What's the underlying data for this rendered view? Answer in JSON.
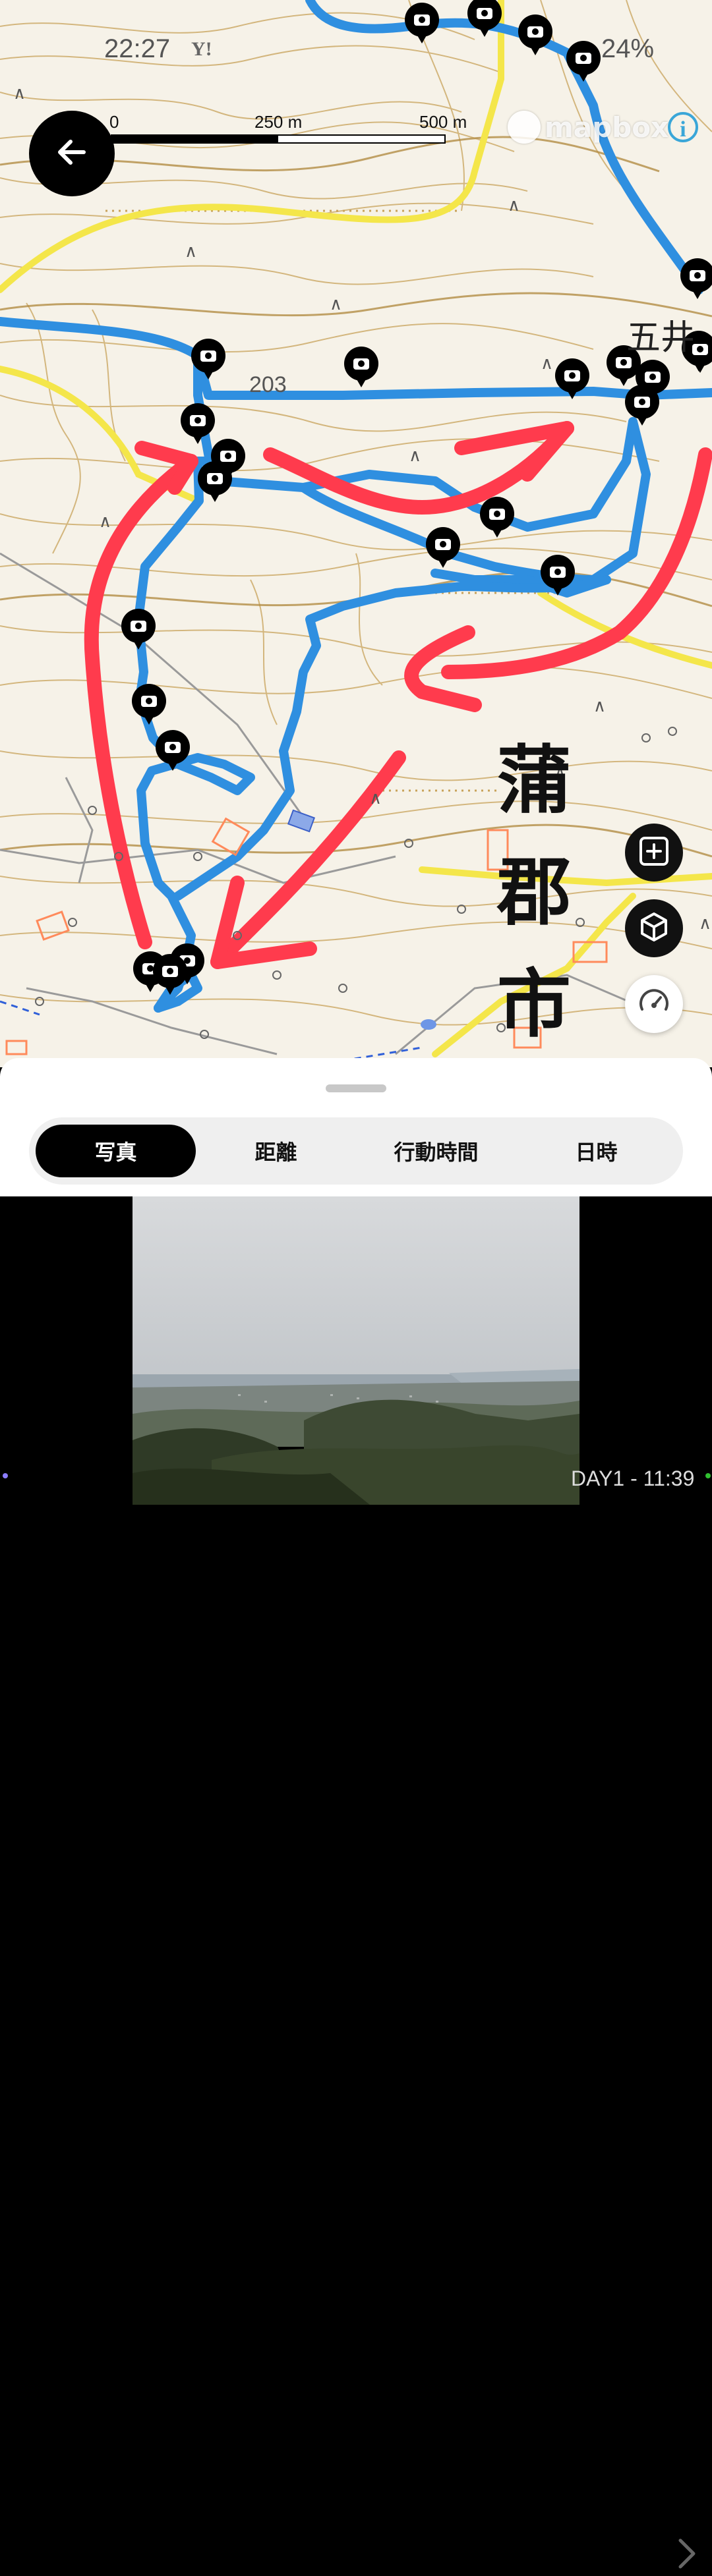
{
  "status_bar": {
    "time": "22:27",
    "carrier_icon": "Y!",
    "battery": "24%"
  },
  "map": {
    "back_icon": "arrow-left-icon",
    "scale": {
      "labels": [
        "0",
        "250 m",
        "500 m"
      ]
    },
    "attribution": "mapbox",
    "info_icon": "i",
    "city_label": "蒲郡市",
    "place_label": "五井",
    "road_label": "203",
    "route_color": "#2f8fe0",
    "arrow_color": "#ff3b4d",
    "yellow_road_color": "#f4e64a",
    "contour_color": "#c8a25a",
    "buttons": {
      "zoom_icon": "zoom-frame-icon",
      "cube_icon": "3d-cube-icon",
      "speed_icon": "speedometer-icon"
    }
  },
  "bottom_sheet": {
    "tabs": [
      {
        "label": "写真",
        "active": true
      },
      {
        "label": "距離",
        "active": false
      },
      {
        "label": "行動時間",
        "active": false
      },
      {
        "label": "日時",
        "active": false
      }
    ]
  },
  "photo_viewer": {
    "caption": "DAY1 - 11:39",
    "next_icon": "chevron-right-icon"
  }
}
